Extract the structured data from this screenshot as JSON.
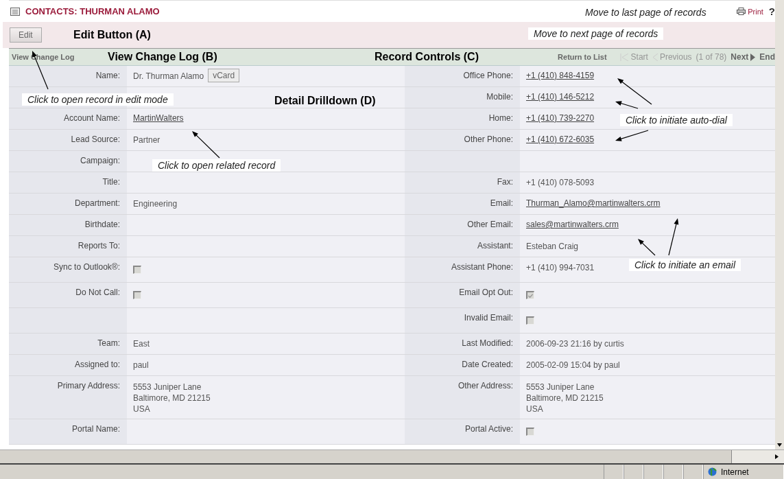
{
  "header": {
    "title": "CONTACTS: THURMAN ALAMO",
    "print": "Print",
    "help": "?"
  },
  "edit_button": "Edit",
  "nav": {
    "change_log": "View Change Log",
    "return": "Return to List",
    "count": "(1 of 78)",
    "pager": [
      {
        "label": "Start",
        "kind": "start",
        "disabled": true
      },
      {
        "label": "Previous",
        "kind": "previous",
        "disabled": true
      },
      {
        "label": "Next",
        "kind": "next",
        "disabled": false
      },
      {
        "label": "End",
        "kind": "end",
        "disabled": false
      }
    ]
  },
  "rows": [
    {
      "left": {
        "label": "Name:",
        "kind": "text",
        "value": "Dr. Thurman Alamo",
        "button": "vCard"
      },
      "right": {
        "label": "Office Phone:",
        "kind": "link",
        "value": "+1 (410) 848-4159"
      }
    },
    {
      "left": null,
      "right": {
        "label": "Mobile:",
        "kind": "link",
        "value": "+1 (410) 146-5212"
      }
    },
    {
      "left": {
        "label": "Account Name:",
        "kind": "link",
        "value": "MartinWalters"
      },
      "right": {
        "label": "Home:",
        "kind": "link",
        "value": "+1 (410) 739-2270"
      }
    },
    {
      "left": {
        "label": "Lead Source:",
        "kind": "text",
        "value": "Partner"
      },
      "right": {
        "label": "Other Phone:",
        "kind": "link",
        "value": "+1 (410) 672-6035"
      }
    },
    {
      "left": {
        "label": "Campaign:",
        "kind": "text"
      },
      "right": null
    },
    {
      "left": {
        "label": "Title:",
        "kind": "text"
      },
      "right": {
        "label": "Fax:",
        "kind": "text",
        "value": "+1 (410) 078-5093"
      }
    },
    {
      "left": {
        "label": "Department:",
        "kind": "text",
        "value": "Engineering"
      },
      "right": {
        "label": "Email:",
        "kind": "link",
        "value": "Thurman_Alamo@martinwalters.crm"
      }
    },
    {
      "left": {
        "label": "Birthdate:",
        "kind": "text"
      },
      "right": {
        "label": "Other Email:",
        "kind": "link",
        "value": "sales@martinwalters.crm"
      }
    },
    {
      "left": {
        "label": "Reports To:",
        "kind": "text"
      },
      "right": {
        "label": "Assistant:",
        "kind": "text",
        "value": "Esteban Craig"
      }
    },
    {
      "left": {
        "label": "Sync to Outlook®:",
        "kind": "checkbox",
        "checked": false
      },
      "right": {
        "label": "Assistant Phone:",
        "kind": "text",
        "value": "+1 (410) 994-7031"
      }
    },
    {
      "left": {
        "label": "Do Not Call:",
        "kind": "checkbox",
        "checked": false
      },
      "right": {
        "label": "Email Opt Out:",
        "kind": "checkbox",
        "checked": true
      }
    },
    {
      "left": null,
      "right": {
        "label": "Invalid Email:",
        "kind": "checkbox",
        "checked": false
      }
    },
    {
      "left": {
        "label": "Team:",
        "kind": "text",
        "value": "East"
      },
      "right": {
        "label": "Last Modified:",
        "kind": "text",
        "value": "2006-09-23 21:16 by curtis"
      }
    },
    {
      "left": {
        "label": "Assigned to:",
        "kind": "text",
        "value": "paul"
      },
      "right": {
        "label": "Date Created:",
        "kind": "text",
        "value": "2005-02-09 15:04 by paul"
      }
    },
    {
      "left": {
        "label": "Primary Address:",
        "kind": "address",
        "lines": [
          "5553 Juniper Lane",
          "Baltimore, MD  21215",
          "USA"
        ]
      },
      "right": {
        "label": "Other Address:",
        "kind": "address",
        "lines": [
          "5553 Juniper Lane",
          "Baltimore, MD  21215",
          "USA"
        ]
      }
    },
    {
      "left": {
        "label": "Portal Name:",
        "kind": "text"
      },
      "right": {
        "label": "Portal Active:",
        "kind": "checkbox",
        "checked": false
      }
    }
  ],
  "annotations": [
    {
      "kind": "heading",
      "text": "Edit Button (A)"
    },
    {
      "kind": "heading",
      "text": "View Change Log (B)"
    },
    {
      "kind": "heading",
      "text": "Record Controls (C)"
    },
    {
      "kind": "heading",
      "text": "Detail Drilldown (D)"
    },
    {
      "kind": "note",
      "text": "Move to last page of records"
    },
    {
      "kind": "note",
      "text": "Move to next page of records"
    },
    {
      "kind": "note",
      "text": "Click to open record in edit mode"
    },
    {
      "kind": "note",
      "text": "Click to open related record"
    },
    {
      "kind": "note",
      "text": "Click to initiate auto-dial"
    },
    {
      "kind": "note",
      "text": "Click to initiate an email"
    }
  ],
  "status_bar": {
    "zone": "Internet"
  }
}
